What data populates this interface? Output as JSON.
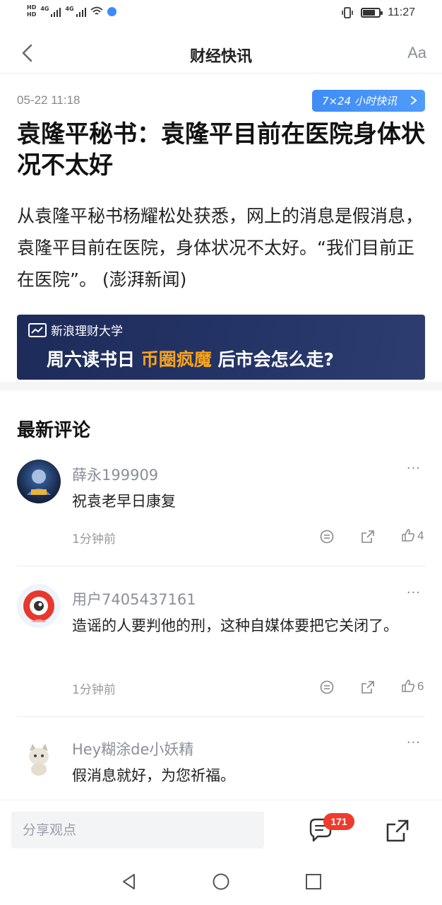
{
  "status_bar": {
    "hd1": "HD",
    "hd2": "HD",
    "net1": "4G",
    "net2": "4G",
    "time": "11:27",
    "battery_level": 0.75
  },
  "nav": {
    "title": "财经快讯",
    "font_button": "Aa"
  },
  "article": {
    "time": "05-22 11:18",
    "tag": "7×24 小时快讯",
    "headline": "袁隆平秘书：袁隆平目前在医院身体状况不太好",
    "body": "从袁隆平秘书杨耀松处获悉，网上的消息是假消息，袁隆平目前在医院，身体状况不太好。“我们目前正在医院”。 (澎湃新闻)",
    "banner": {
      "brand": "新浪理财大学",
      "slogan_a": "周六读书日",
      "slogan_b": "币圈疯魔",
      "slogan_c": "后市会怎么走?"
    }
  },
  "comments_section": {
    "title": "最新评论",
    "more": "···",
    "items": [
      {
        "user": "薛永199909",
        "text": "祝袁老早日康复",
        "time": "1分钟前",
        "likes": "4"
      },
      {
        "user": "用户7405437161",
        "text": "造谣的人要判他的刑，这种自媒体要把它关闭了。",
        "time": "1分钟前",
        "likes": "6"
      },
      {
        "user": "Hey糊涂de小妖精",
        "text": "假消息就好，为您祈福。"
      }
    ]
  },
  "bottom_bar": {
    "placeholder": "分享观点",
    "comment_count": "171"
  },
  "colors": {
    "accent": "#3f8cf5",
    "badge": "#ee3b2d",
    "banner_highlight": "#f7a31b",
    "banner_bg": "#1d2b5a"
  }
}
